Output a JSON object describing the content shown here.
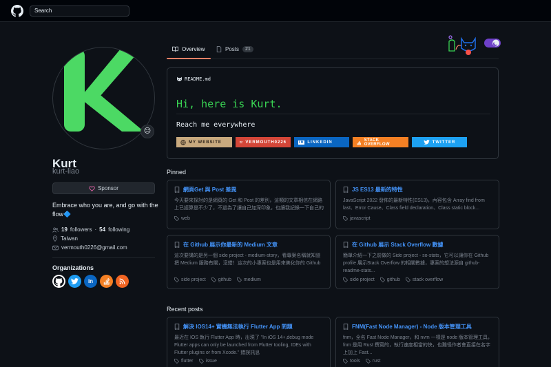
{
  "header": {
    "search_placeholder": "Search"
  },
  "tabs": [
    {
      "label": "Overview"
    },
    {
      "label": "Posts",
      "count": "21"
    }
  ],
  "profile": {
    "name": "Kurt",
    "login": "kurt-liao",
    "sponsor_label": "Sponsor",
    "bio": "Embrace who you are, and go with the flow🔷",
    "followers_count": "19",
    "followers_label": "followers",
    "following_count": "54",
    "following_label": "following",
    "location": "Taiwan",
    "email": "vermouth0226@gmail.com",
    "status_emoji": "😑"
  },
  "organizations": {
    "title": "Organizations",
    "items": [
      "github-icon",
      "twitter-icon",
      "linkedin-icon",
      "stackoverflow-icon",
      "rss-icon"
    ]
  },
  "readme": {
    "label": "README.md",
    "greeting": "Hi, here is Kurt.",
    "subheading": "Reach me everywhere",
    "badges": [
      {
        "label": "MY WEBSITE",
        "color": "#c8a97e"
      },
      {
        "label": "VERMOUTH0226",
        "color": "#d44638"
      },
      {
        "label": "LINKEDIN",
        "color": "#0a66c2"
      },
      {
        "label": "STACK OVERFLOW",
        "color": "#f48024"
      },
      {
        "label": "TWITTER",
        "color": "#1da1f2"
      }
    ]
  },
  "pinned": {
    "title": "Pinned",
    "cards": [
      {
        "title": "網頁Get 與 Post 差異",
        "desc": "今天要來探討的是網頁的 Get 和 Post 的差別，這類的文章相信在網路上已經算是不少了，不過為了讓自己加深印象，也讓我記錄一下自己的學習過程...",
        "tags": [
          "web"
        ]
      },
      {
        "title": "JS ES13 最新的特性",
        "desc": "JavaScript 2022 發佈的最新特性(ES13)，內容包含 Array find from last、Error Cause、Class field declaration、Class static block...",
        "tags": [
          "javascript"
        ]
      },
      {
        "title": "在 Github 展示你最新的 Medium 文章",
        "desc": "這次要講的是另一個 side project - medium-story，看專案名稱就知道把 Medium 服務有關，沒錯！這次的小專案也是用來美化你的 Github profile...",
        "tags": [
          "side project",
          "github",
          "medium"
        ]
      },
      {
        "title": "在 Github 展示 Stack Overflow 數據",
        "desc": "簡單介紹一下之前做的 Side project - so-stats，它可以讓你在 Github profile 展示Stack Overflow 的相關數據，專案的想法源自 github-readme-stats...",
        "tags": [
          "side project",
          "github",
          "stack overflow"
        ]
      }
    ]
  },
  "recent": {
    "title": "Recent posts",
    "cards": [
      {
        "title": "解決 IOS14+ 實機無法執行 Flutter App 問題",
        "desc": "最近在 IOS 執行 Flutter App 時，出現了 \"In iOS 14+,debug mode Flutter apps can only be launched from Flutter tooling, IDEs with Flutter plugins or from Xcode.\" 錯誤訊息",
        "tags": [
          "flutter",
          "issue"
        ]
      },
      {
        "title": "FNM(Fast Node Manager) - Node 版本管理工具",
        "desc": "fnm，全名 Fast Node Manager，和 nvm 一樣是 node 版本管理工具，fnm 是用 Rust 撰寫的，執行速度相當的快，也難怪作者會直接在名字上加上 Fast...",
        "tags": [
          "tools",
          "rust"
        ]
      }
    ]
  }
}
